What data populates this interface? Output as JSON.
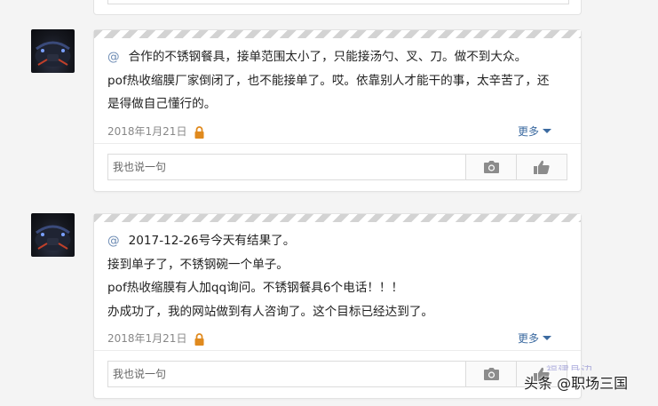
{
  "comments": [
    {
      "mention": "@",
      "lines": [
        "合作的不锈钢餐具，接单范围太小了，只能接汤勺、叉、刀。做不到大众。",
        "pof热收缩膜厂家倒闭了，也不能接单了。哎。依靠别人才能干的事，太辛苦了，还",
        "是得做自己懂行的。"
      ],
      "date": "2018年1月21日",
      "more_label": "更多",
      "reply_placeholder": "我也说一句"
    },
    {
      "mention": "@",
      "lines": [
        "2017-12-26号今天有结果了。",
        "接到单子了，不锈钢碗一个单子。",
        "pof热收缩膜有人加qq询问。不锈钢餐具6个电话！！！",
        "办成功了，我的网站做到有人咨询了。这个目标已经达到了。"
      ],
      "date": "2018年1月21日",
      "more_label": "更多",
      "reply_placeholder": "我也说一句"
    }
  ],
  "watermark": {
    "text": "头条 @职场三国",
    "sub_text": "福建身边"
  },
  "colors": {
    "link": "#3b6aa0",
    "lock": "#e08a1e",
    "mention": "#6b8ab3"
  }
}
